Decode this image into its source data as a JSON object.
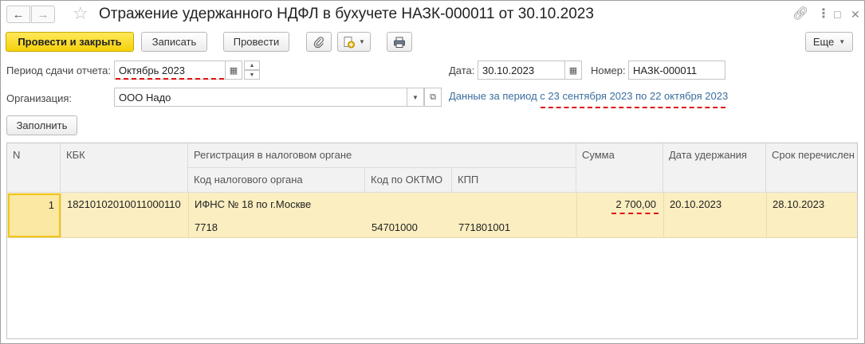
{
  "window": {
    "title": "Отражение удержанного НДФЛ в бухучете НАЗК-000011 от 30.10.2023",
    "back_icon": "arrow-left",
    "forward_icon": "arrow-right",
    "favorite_icon": "star",
    "link_icon": "link",
    "more_icon": "vertical-dots",
    "maximize_icon": "square",
    "close_icon": "cross"
  },
  "toolbar": {
    "post_close": "Провести и закрыть",
    "save": "Записать",
    "post": "Провести",
    "attach_icon": "paperclip",
    "create_icon": "create-based-on",
    "print_icon": "printer",
    "more": "Еще"
  },
  "form": {
    "period_label": "Период сдачи отчета:",
    "period_value": "Октябрь 2023",
    "date_label": "Дата:",
    "date_value": "30.10.2023",
    "number_label": "Номер:",
    "number_value": "НАЗК-000011",
    "org_label": "Организация:",
    "org_value": "ООО Надо",
    "period_link_prefix": "Данные за период",
    "period_link_range": "с 23 сентября 2023 по 22 октября 2023",
    "fill_button": "Заполнить"
  },
  "table": {
    "headers": {
      "n": "N",
      "kbk": "КБК",
      "registration": "Регистрация в налоговом органе",
      "tax_code": "Код налогового органа",
      "oktmo": "Код по ОКТМО",
      "kpp": "КПП",
      "sum": "Сумма",
      "withhold_date": "Дата удержания",
      "transfer_deadline": "Срок перечислен"
    },
    "rows": [
      {
        "n": "1",
        "kbk": "18210102010011000110",
        "registration": "ИФНС № 18 по г.Москве",
        "tax_code": "7718",
        "oktmo": "54701000",
        "kpp": "771801001",
        "sum": "2 700,00",
        "withhold_date": "20.10.2023",
        "transfer_deadline": "28.10.2023"
      }
    ]
  },
  "colors": {
    "primary_button": "#f5d20a",
    "selected_row": "#fbeec0",
    "current_cell_border": "#f0c419",
    "link": "#3a6e9e",
    "annotation_underline": "#e01010"
  }
}
